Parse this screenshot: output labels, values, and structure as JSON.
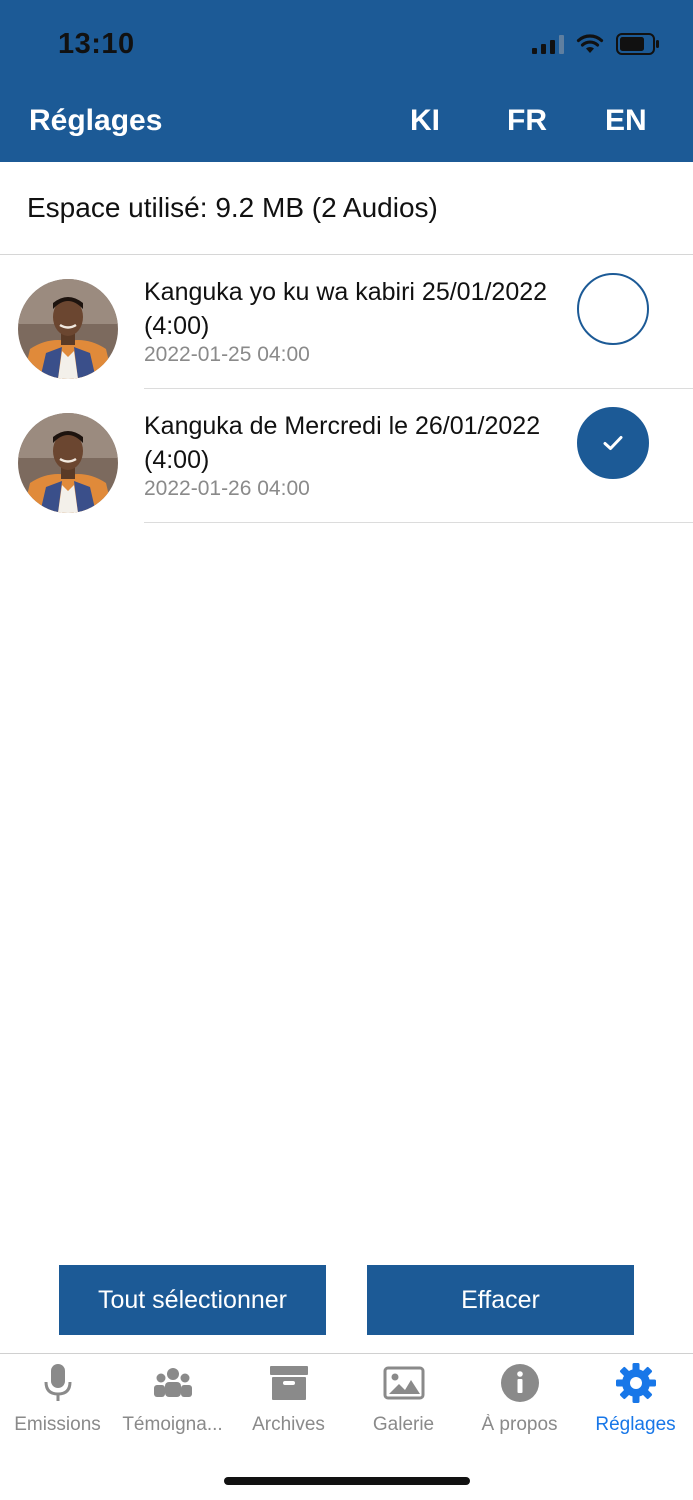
{
  "status_bar": {
    "time": "13:10"
  },
  "header": {
    "title": "Réglages",
    "languages": [
      "KI",
      "FR",
      "EN"
    ]
  },
  "storage": {
    "label": "Espace utilisé: 9.2 MB (2 Audios)"
  },
  "items": [
    {
      "title": "Kanguka yo ku wa kabiri 25/01/2022 (4:00)",
      "date": "2022-01-25 04:00",
      "selected": false
    },
    {
      "title": "Kanguka de Mercredi le 26/01/2022 (4:00)",
      "date": "2022-01-26 04:00",
      "selected": true
    }
  ],
  "actions": {
    "select_all": "Tout sélectionner",
    "delete": "Effacer"
  },
  "tabs": [
    {
      "label": "Emissions",
      "icon": "microphone-icon"
    },
    {
      "label": "Témoigna...",
      "icon": "users-icon"
    },
    {
      "label": "Archives",
      "icon": "archive-box-icon"
    },
    {
      "label": "Galerie",
      "icon": "image-icon"
    },
    {
      "label": "À propos",
      "icon": "info-icon"
    },
    {
      "label": "Réglages",
      "icon": "gear-icon",
      "active": true
    }
  ],
  "colors": {
    "primary": "#1c5a96",
    "active_tab": "#1877e8",
    "inactive_tab": "#8a8a8a"
  }
}
